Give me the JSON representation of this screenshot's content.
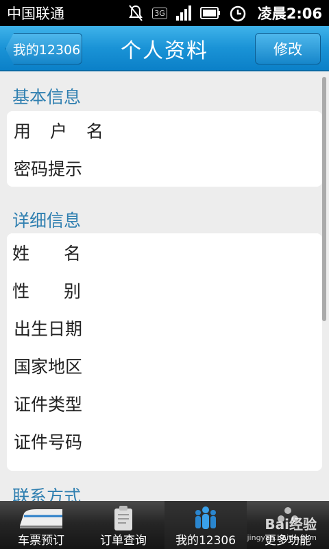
{
  "status_bar": {
    "carrier": "中国联通",
    "network": "3G",
    "time": "凌晨2:06"
  },
  "header": {
    "back_label": "我的12306",
    "title": "个人资料",
    "edit_label": "修改"
  },
  "sections": [
    {
      "title": "基本信息",
      "rows": [
        "用 户 名",
        "密码提示"
      ]
    },
    {
      "title": "详细信息",
      "rows": [
        "姓　　名",
        "性　　别",
        "出生日期",
        "国家地区",
        "证件类型",
        "证件号码"
      ]
    },
    {
      "title": "联系方式",
      "rows": []
    }
  ],
  "bottom_nav": {
    "items": [
      {
        "label": "车票预订",
        "icon": "train-icon"
      },
      {
        "label": "订单查询",
        "icon": "clipboard-icon"
      },
      {
        "label": "我的12306",
        "icon": "people-icon",
        "active": true
      },
      {
        "label": "更多功能",
        "icon": "more-icon"
      }
    ]
  },
  "watermark": {
    "line1": "Bai经验",
    "line2": "jingyan.baidu.com"
  }
}
